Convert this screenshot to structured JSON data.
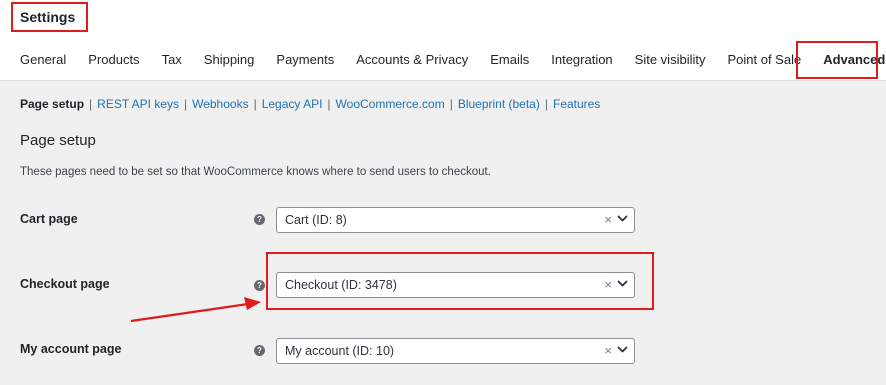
{
  "header": {
    "title": "Settings"
  },
  "tabs": [
    {
      "label": "General"
    },
    {
      "label": "Products"
    },
    {
      "label": "Tax"
    },
    {
      "label": "Shipping"
    },
    {
      "label": "Payments"
    },
    {
      "label": "Accounts & Privacy"
    },
    {
      "label": "Emails"
    },
    {
      "label": "Integration"
    },
    {
      "label": "Site visibility"
    },
    {
      "label": "Point of Sale"
    },
    {
      "label": "Advanced"
    }
  ],
  "subnav": [
    {
      "label": "Page setup"
    },
    {
      "label": "REST API keys"
    },
    {
      "label": "Webhooks"
    },
    {
      "label": "Legacy API"
    },
    {
      "label": "WooCommerce.com"
    },
    {
      "label": "Blueprint (beta)"
    },
    {
      "label": "Features"
    }
  ],
  "section": {
    "title": "Page setup",
    "description": "These pages need to be set so that WooCommerce knows where to send users to checkout."
  },
  "rows": [
    {
      "label": "Cart page",
      "value": "Cart (ID: 8)"
    },
    {
      "label": "Checkout page",
      "value": "Checkout (ID: 3478)"
    },
    {
      "label": "My account page",
      "value": "My account (ID: 10)"
    }
  ],
  "ui": {
    "help_glyph": "?",
    "clear_glyph": "×",
    "separator": "|"
  },
  "colors": {
    "highlight": "#e01b1b",
    "link": "#2271b1",
    "background": "#f0f0f1"
  },
  "icons": [
    "help-icon",
    "clear-icon",
    "chevron-down-icon",
    "arrow-annotation"
  ]
}
